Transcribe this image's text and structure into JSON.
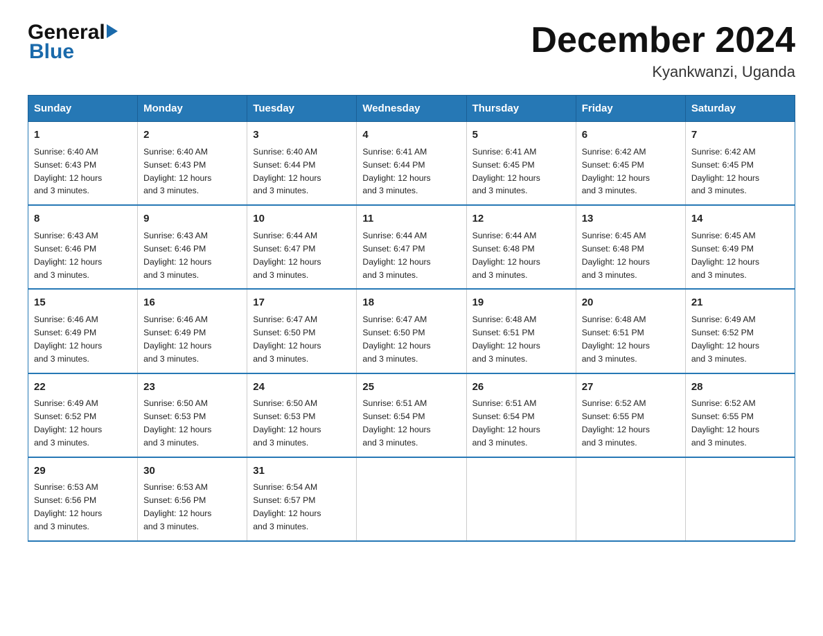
{
  "header": {
    "logo_general": "General",
    "logo_blue": "Blue",
    "title": "December 2024",
    "location": "Kyankwanzi, Uganda"
  },
  "days_of_week": [
    "Sunday",
    "Monday",
    "Tuesday",
    "Wednesday",
    "Thursday",
    "Friday",
    "Saturday"
  ],
  "weeks": [
    [
      {
        "num": "1",
        "sunrise": "6:40 AM",
        "sunset": "6:43 PM",
        "daylight": "12 hours and 3 minutes."
      },
      {
        "num": "2",
        "sunrise": "6:40 AM",
        "sunset": "6:43 PM",
        "daylight": "12 hours and 3 minutes."
      },
      {
        "num": "3",
        "sunrise": "6:40 AM",
        "sunset": "6:44 PM",
        "daylight": "12 hours and 3 minutes."
      },
      {
        "num": "4",
        "sunrise": "6:41 AM",
        "sunset": "6:44 PM",
        "daylight": "12 hours and 3 minutes."
      },
      {
        "num": "5",
        "sunrise": "6:41 AM",
        "sunset": "6:45 PM",
        "daylight": "12 hours and 3 minutes."
      },
      {
        "num": "6",
        "sunrise": "6:42 AM",
        "sunset": "6:45 PM",
        "daylight": "12 hours and 3 minutes."
      },
      {
        "num": "7",
        "sunrise": "6:42 AM",
        "sunset": "6:45 PM",
        "daylight": "12 hours and 3 minutes."
      }
    ],
    [
      {
        "num": "8",
        "sunrise": "6:43 AM",
        "sunset": "6:46 PM",
        "daylight": "12 hours and 3 minutes."
      },
      {
        "num": "9",
        "sunrise": "6:43 AM",
        "sunset": "6:46 PM",
        "daylight": "12 hours and 3 minutes."
      },
      {
        "num": "10",
        "sunrise": "6:44 AM",
        "sunset": "6:47 PM",
        "daylight": "12 hours and 3 minutes."
      },
      {
        "num": "11",
        "sunrise": "6:44 AM",
        "sunset": "6:47 PM",
        "daylight": "12 hours and 3 minutes."
      },
      {
        "num": "12",
        "sunrise": "6:44 AM",
        "sunset": "6:48 PM",
        "daylight": "12 hours and 3 minutes."
      },
      {
        "num": "13",
        "sunrise": "6:45 AM",
        "sunset": "6:48 PM",
        "daylight": "12 hours and 3 minutes."
      },
      {
        "num": "14",
        "sunrise": "6:45 AM",
        "sunset": "6:49 PM",
        "daylight": "12 hours and 3 minutes."
      }
    ],
    [
      {
        "num": "15",
        "sunrise": "6:46 AM",
        "sunset": "6:49 PM",
        "daylight": "12 hours and 3 minutes."
      },
      {
        "num": "16",
        "sunrise": "6:46 AM",
        "sunset": "6:49 PM",
        "daylight": "12 hours and 3 minutes."
      },
      {
        "num": "17",
        "sunrise": "6:47 AM",
        "sunset": "6:50 PM",
        "daylight": "12 hours and 3 minutes."
      },
      {
        "num": "18",
        "sunrise": "6:47 AM",
        "sunset": "6:50 PM",
        "daylight": "12 hours and 3 minutes."
      },
      {
        "num": "19",
        "sunrise": "6:48 AM",
        "sunset": "6:51 PM",
        "daylight": "12 hours and 3 minutes."
      },
      {
        "num": "20",
        "sunrise": "6:48 AM",
        "sunset": "6:51 PM",
        "daylight": "12 hours and 3 minutes."
      },
      {
        "num": "21",
        "sunrise": "6:49 AM",
        "sunset": "6:52 PM",
        "daylight": "12 hours and 3 minutes."
      }
    ],
    [
      {
        "num": "22",
        "sunrise": "6:49 AM",
        "sunset": "6:52 PM",
        "daylight": "12 hours and 3 minutes."
      },
      {
        "num": "23",
        "sunrise": "6:50 AM",
        "sunset": "6:53 PM",
        "daylight": "12 hours and 3 minutes."
      },
      {
        "num": "24",
        "sunrise": "6:50 AM",
        "sunset": "6:53 PM",
        "daylight": "12 hours and 3 minutes."
      },
      {
        "num": "25",
        "sunrise": "6:51 AM",
        "sunset": "6:54 PM",
        "daylight": "12 hours and 3 minutes."
      },
      {
        "num": "26",
        "sunrise": "6:51 AM",
        "sunset": "6:54 PM",
        "daylight": "12 hours and 3 minutes."
      },
      {
        "num": "27",
        "sunrise": "6:52 AM",
        "sunset": "6:55 PM",
        "daylight": "12 hours and 3 minutes."
      },
      {
        "num": "28",
        "sunrise": "6:52 AM",
        "sunset": "6:55 PM",
        "daylight": "12 hours and 3 minutes."
      }
    ],
    [
      {
        "num": "29",
        "sunrise": "6:53 AM",
        "sunset": "6:56 PM",
        "daylight": "12 hours and 3 minutes."
      },
      {
        "num": "30",
        "sunrise": "6:53 AM",
        "sunset": "6:56 PM",
        "daylight": "12 hours and 3 minutes."
      },
      {
        "num": "31",
        "sunrise": "6:54 AM",
        "sunset": "6:57 PM",
        "daylight": "12 hours and 3 minutes."
      },
      null,
      null,
      null,
      null
    ]
  ],
  "labels": {
    "sunrise": "Sunrise:",
    "sunset": "Sunset:",
    "daylight": "Daylight:"
  }
}
